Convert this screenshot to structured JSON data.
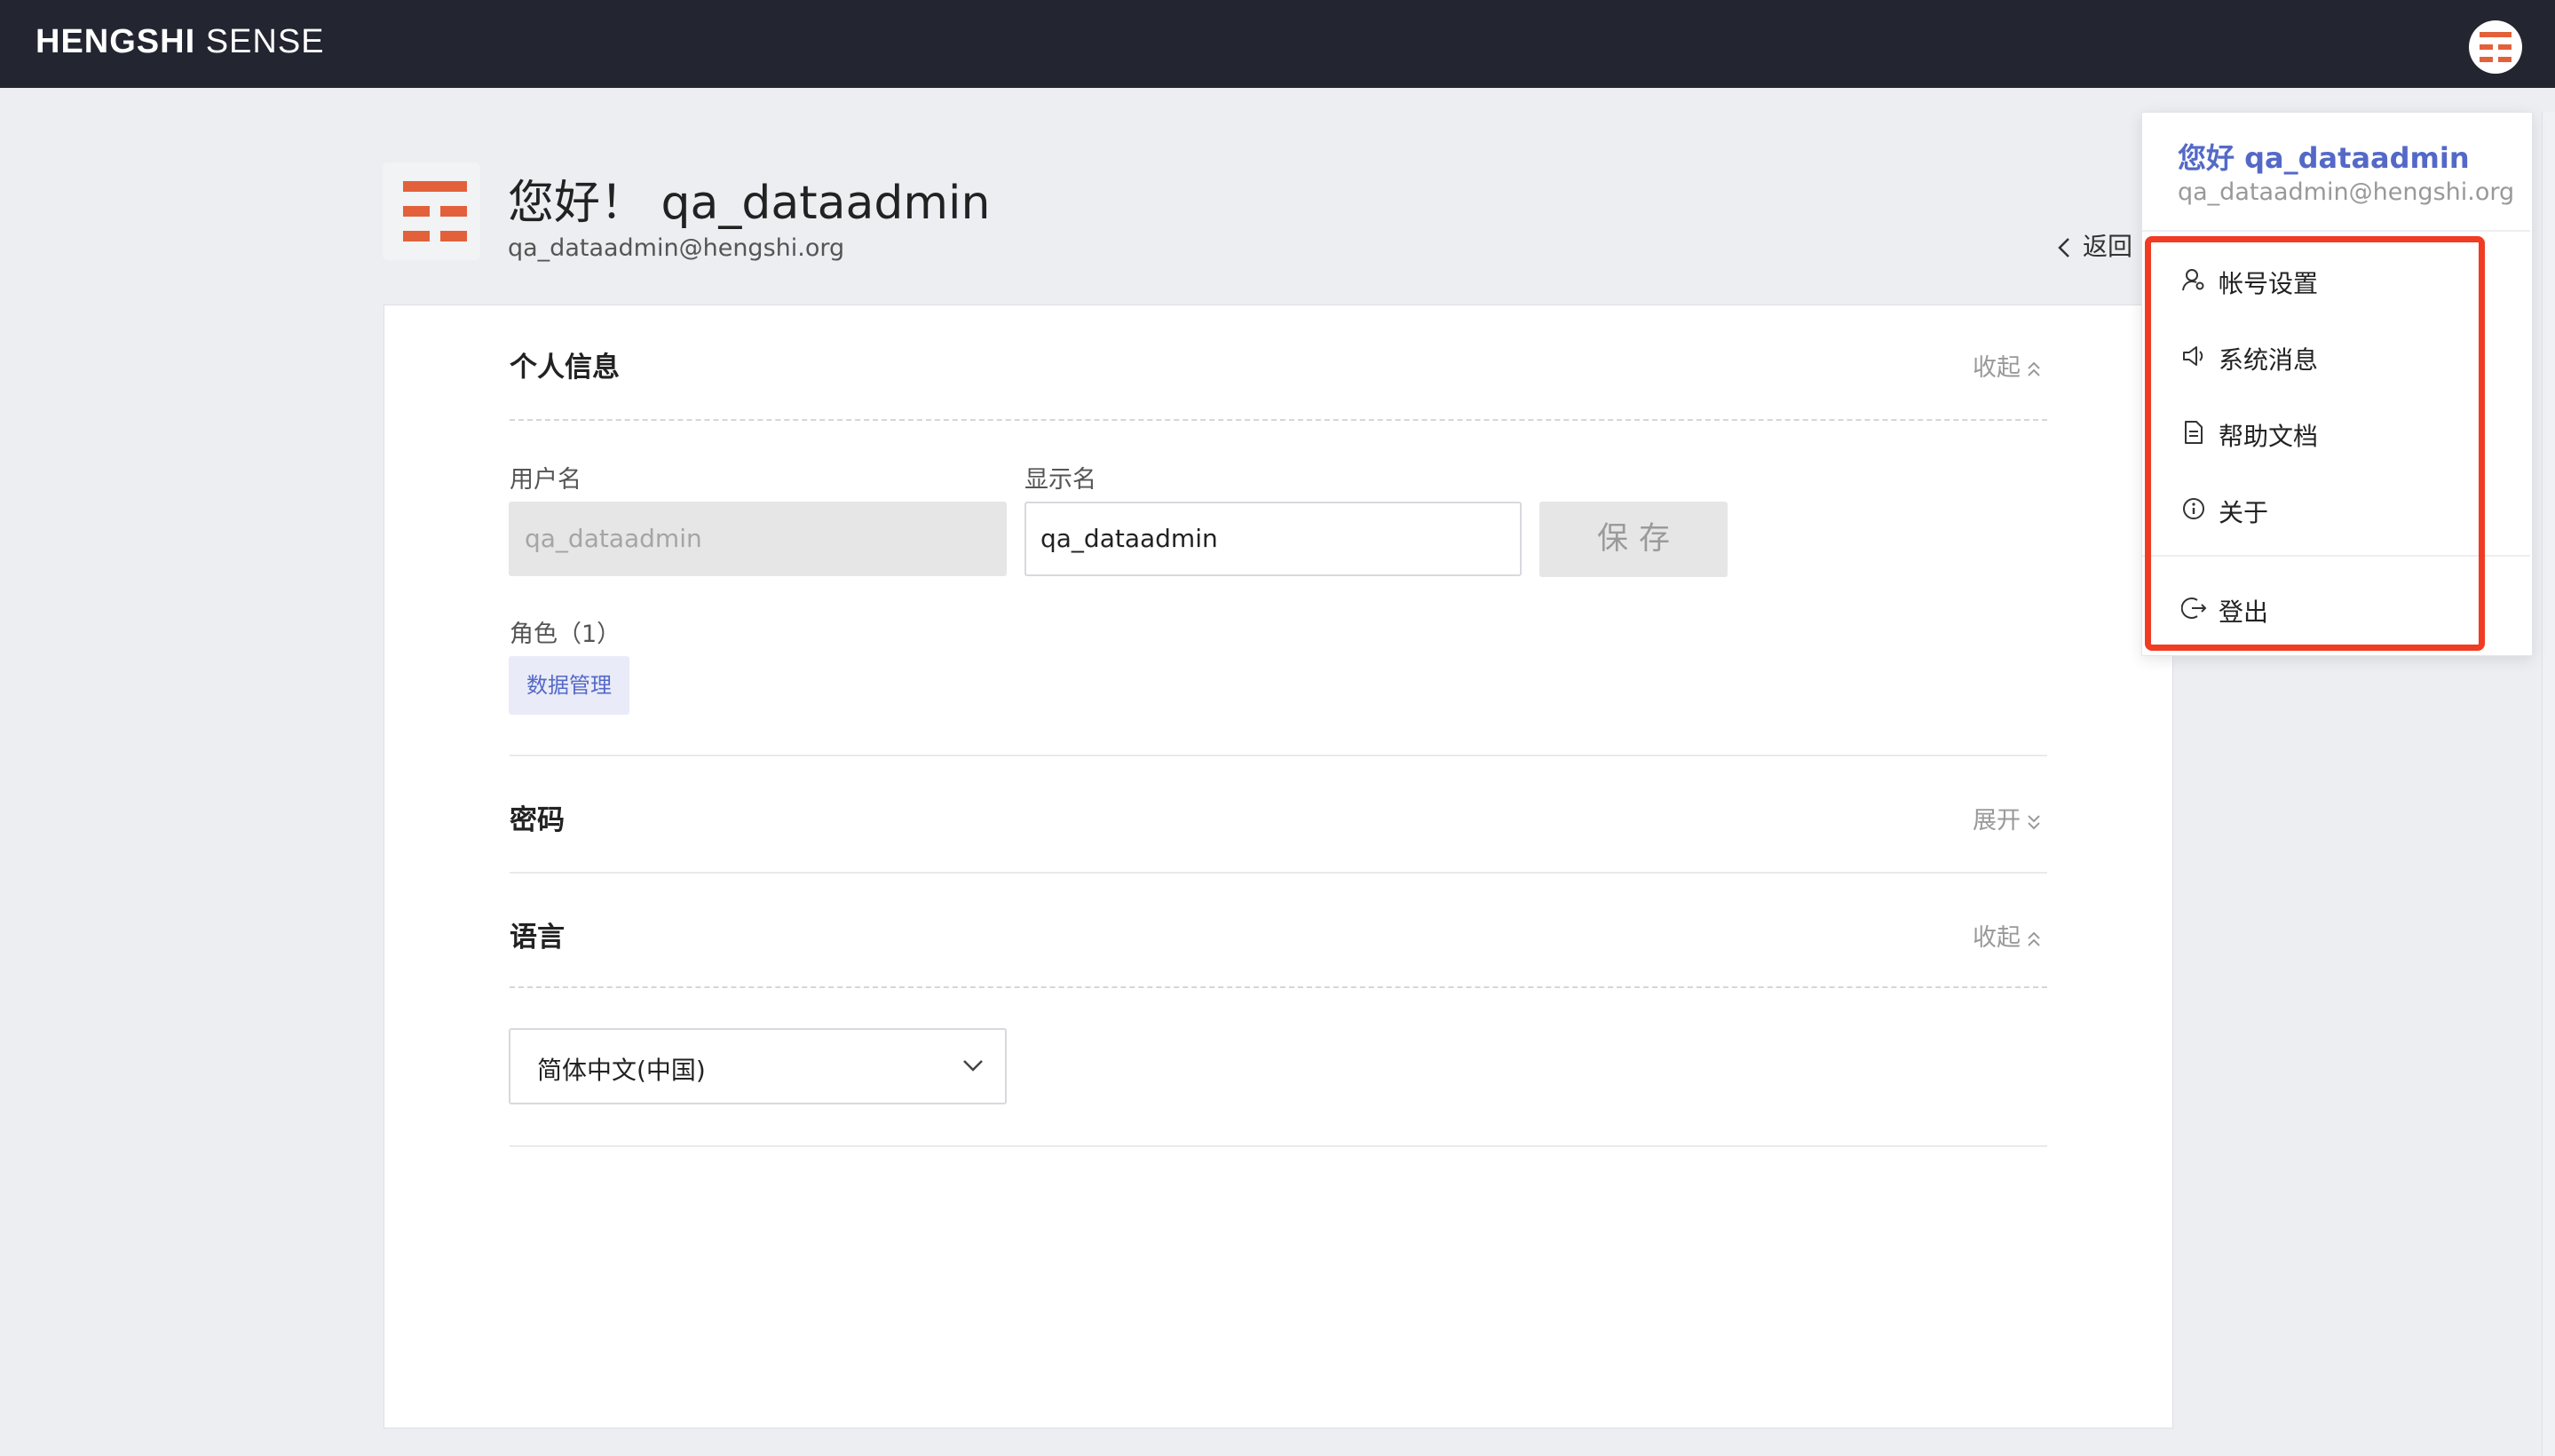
{
  "header": {
    "brand_bold": "HENGSHI",
    "brand_light": "SENSE"
  },
  "profile": {
    "greeting": "您好！ qa_dataadmin",
    "email": "qa_dataadmin@hengshi.org",
    "back_label": "返回"
  },
  "personal_info": {
    "title": "个人信息",
    "toggle_label": "收起",
    "username_label": "用户名",
    "username_value": "qa_dataadmin",
    "display_name_label": "显示名",
    "display_name_value": "qa_dataadmin",
    "save_label": "保存",
    "roles_label": "角色（1）",
    "roles": [
      "数据管理"
    ]
  },
  "password": {
    "title": "密码",
    "toggle_label": "展开"
  },
  "language": {
    "title": "语言",
    "toggle_label": "收起",
    "selected": "简体中文(中国)"
  },
  "user_menu": {
    "hello": "您好 qa_dataadmin",
    "email": "qa_dataadmin@hengshi.org",
    "items": [
      {
        "label": "帐号设置",
        "icon": "user-settings-icon"
      },
      {
        "label": "系统消息",
        "icon": "megaphone-icon"
      },
      {
        "label": "帮助文档",
        "icon": "document-icon"
      },
      {
        "label": "关于",
        "icon": "info-icon"
      }
    ],
    "logout_label": "登出"
  },
  "colors": {
    "brand_orange": "#e2613b",
    "topbar": "#232631",
    "accent_blue": "#5469c7",
    "highlight_red": "#f03c23"
  }
}
